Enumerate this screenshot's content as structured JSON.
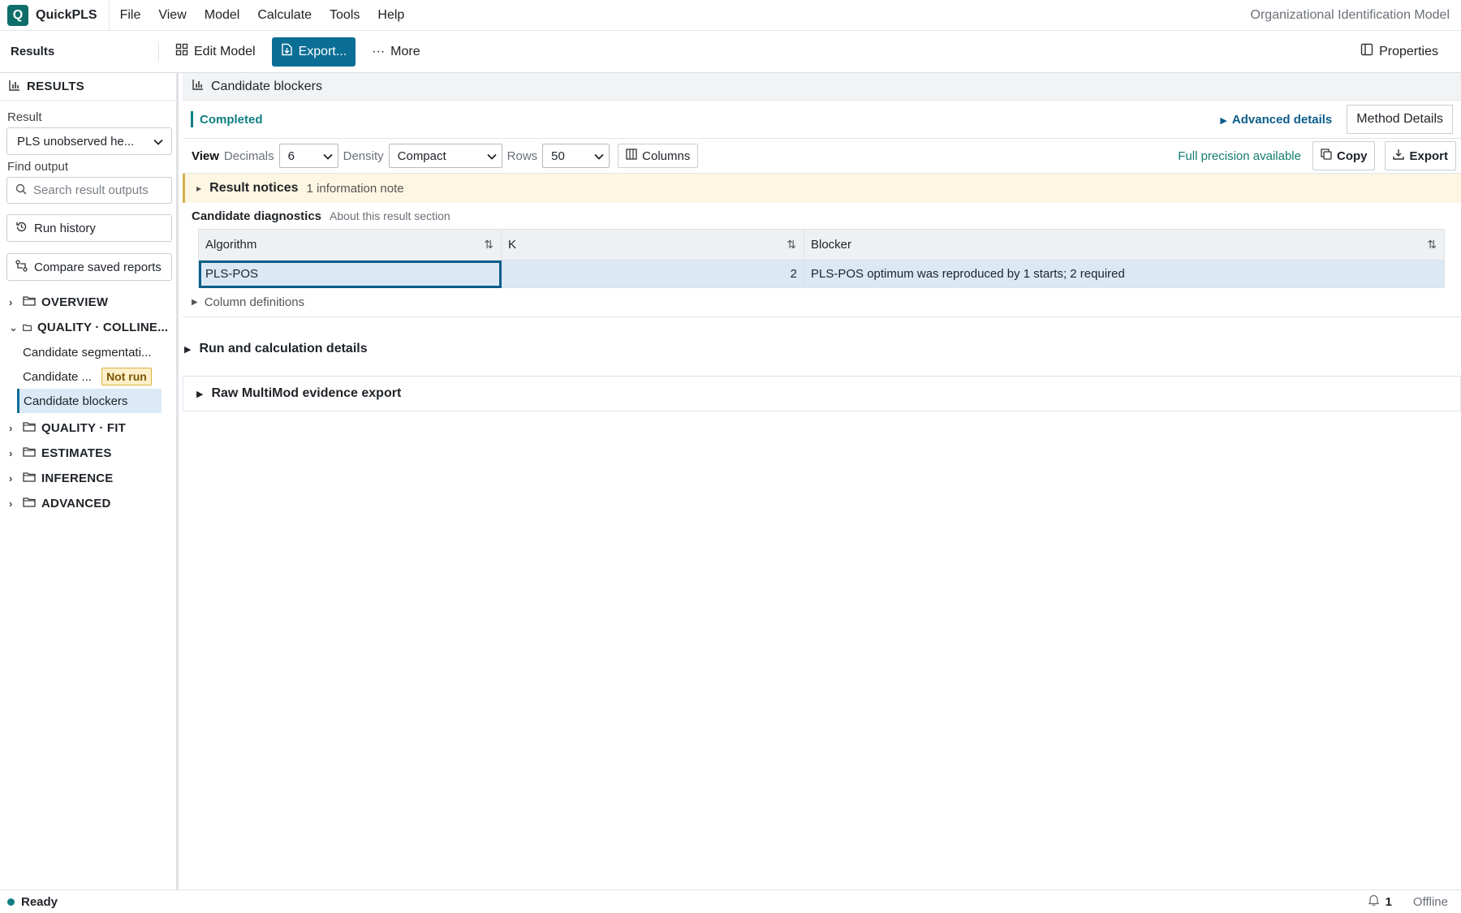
{
  "app": {
    "name": "QuickPLS",
    "logo_letter": "Q",
    "model_title": "Organizational Identification Model",
    "accent": "#0b6e95"
  },
  "menu": [
    "File",
    "View",
    "Model",
    "Calculate",
    "Tools",
    "Help"
  ],
  "toolbar": {
    "section": "Results",
    "edit_model": "Edit Model",
    "export": "Export...",
    "more": "More",
    "properties": "Properties"
  },
  "sidebar": {
    "header": "RESULTS",
    "result_label": "Result",
    "result_value": "PLS unobserved he...",
    "find_label": "Find output",
    "search_placeholder": "Search result outputs",
    "run_history": "Run history",
    "compare": "Compare saved reports",
    "folders": {
      "overview": "OVERVIEW",
      "quality_collin": "QUALITY · COLLINE...",
      "quality_fit": "QUALITY · FIT",
      "estimates": "ESTIMATES",
      "inference": "INFERENCE",
      "advanced": "ADVANCED"
    },
    "leaves": {
      "seg": "Candidate segmentati...",
      "cand": "Candidate ...",
      "cand_badge": "Not run",
      "blockers": "Candidate blockers"
    }
  },
  "main": {
    "title": "Candidate blockers",
    "status": "Completed",
    "advanced": "Advanced details",
    "method": "Method Details",
    "view": {
      "label": "View",
      "decimals_label": "Decimals",
      "decimals": "6",
      "density_label": "Density",
      "density": "Compact",
      "rows_label": "Rows",
      "rows": "50",
      "columns": "Columns",
      "full_precision": "Full precision available",
      "copy": "Copy",
      "export": "Export"
    },
    "notice": {
      "title": "Result notices",
      "sub": "1 information note"
    },
    "section": {
      "title": "Candidate diagnostics",
      "sub": "About this result section"
    },
    "table": {
      "headers": [
        "Algorithm",
        "K",
        "Blocker"
      ],
      "rows": [
        [
          "PLS-POS",
          "2",
          "PLS-POS optimum was reproduced by 1 starts; 2 required"
        ]
      ]
    },
    "col_defs": "Column definitions",
    "run_details": "Run and calculation details",
    "raw": "Raw MultiMod evidence export"
  },
  "status": {
    "ready": "Ready",
    "notifications": "1",
    "connection": "Offline"
  }
}
